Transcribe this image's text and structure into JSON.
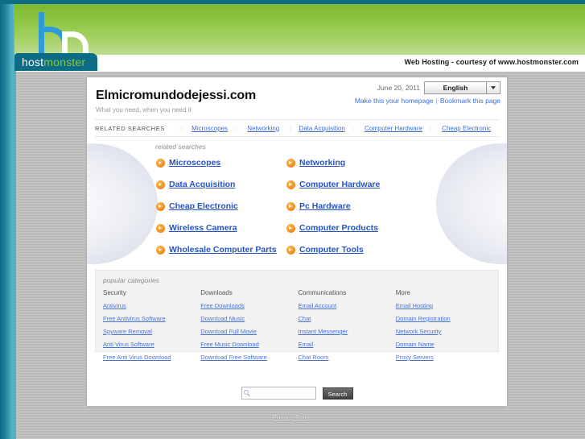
{
  "masthead": {
    "brand_host": "host",
    "brand_monster": "monster",
    "tagline": "Web Hosting - courtesy of www.hostmonster.com"
  },
  "card": {
    "site_title": "Elmicromundodejessi.com",
    "site_subtitle": "What you need, when you need it",
    "date": "June 20, 2011",
    "language": "English",
    "homepage_link": "Make this your homepage",
    "link_separator": "|",
    "bookmark_link": "Bookmark this page"
  },
  "related_bar": {
    "label": "RELATED SEARCHES",
    "dots": "::",
    "links": [
      "Microscopes",
      "Networking",
      "Data Acquisition",
      "Computer Hardware",
      "Cheap Electronic"
    ]
  },
  "related_panel": {
    "heading": "related searches",
    "items": [
      "Microscopes",
      "Networking",
      "Data Acquisition",
      "Computer Hardware",
      "Cheap Electronic",
      "Pc Hardware",
      "Wireless Camera",
      "Computer Products",
      "Wholesale Computer Parts",
      "Computer Tools"
    ]
  },
  "popular": {
    "heading": "popular categories",
    "columns": [
      {
        "title": "Security",
        "links": [
          "Antivirus",
          "Free Antivirus Software",
          "Spyware Removal",
          "Anti Virus Software",
          "Free Anti Virus Download"
        ]
      },
      {
        "title": "Downloads",
        "links": [
          "Free Downloads",
          "Download Music",
          "Download Full Movie",
          "Free Music Download",
          "Download Free Software"
        ]
      },
      {
        "title": "Communications",
        "links": [
          "Email Account",
          "Chat",
          "Instant Messenger",
          "Email",
          "Chat Room"
        ]
      },
      {
        "title": "More",
        "links": [
          "Email Hosting",
          "Domain Registration",
          "Network Security",
          "Domain Name",
          "Proxy Servers"
        ]
      }
    ]
  },
  "search": {
    "value": "",
    "placeholder": "",
    "button_label": "Search",
    "icon": "search-icon"
  },
  "footer": {
    "privacy_label": "Privacy Policy"
  },
  "colors": {
    "brand_teal": "#0c6b85",
    "brand_green": "#8cc63f",
    "link_blue": "#2554c7",
    "accent_orange": "#f08a1c"
  }
}
